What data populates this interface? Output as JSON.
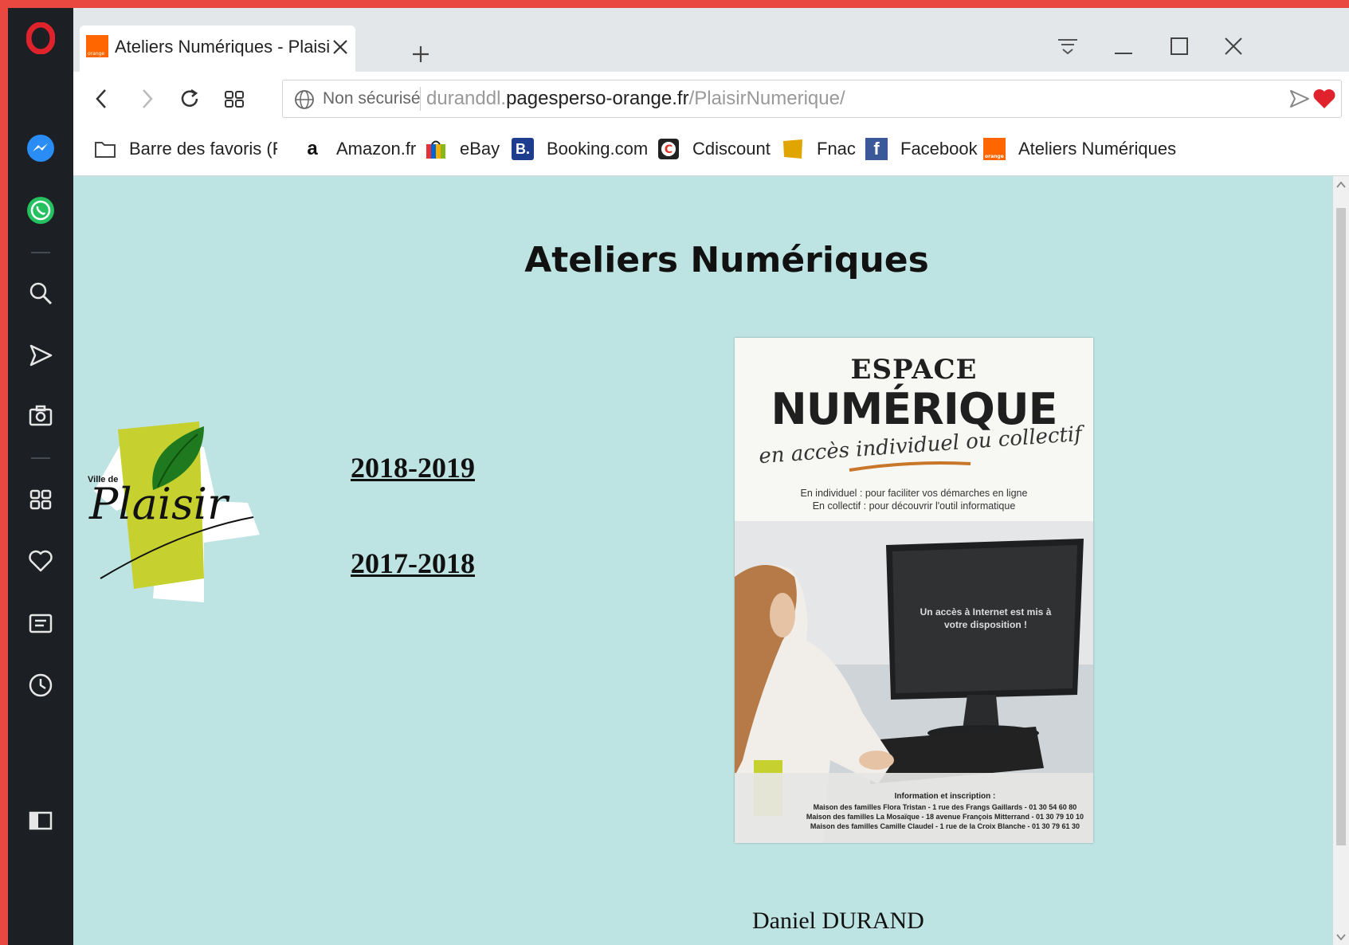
{
  "browser": {
    "tab": {
      "title": "Ateliers Numériques - Plaisir Numérique"
    },
    "address": {
      "security": "Non sécurisé",
      "url_prefix": "duranddl.",
      "url_domain": "pagesperso-orange.fr",
      "url_path": "/PlaisirNumerique/"
    },
    "bookmarks": [
      {
        "label": "Barre des favoris (Fire",
        "icon": "folder-icon"
      },
      {
        "label": "Amazon.fr",
        "icon": "amazon-icon"
      },
      {
        "label": "eBay",
        "icon": "ebay-icon"
      },
      {
        "label": "Booking.com",
        "icon": "booking-icon"
      },
      {
        "label": "Cdiscount",
        "icon": "cdiscount-icon"
      },
      {
        "label": "Fnac",
        "icon": "fnac-icon"
      },
      {
        "label": "Facebook",
        "icon": "facebook-icon"
      },
      {
        "label": "Ateliers Numériques",
        "icon": "orange-icon"
      }
    ]
  },
  "page": {
    "title": "Ateliers Numériques",
    "logo": {
      "small": "Ville de",
      "name": "Plaisir"
    },
    "links": [
      "2018-2019",
      "2017-2018"
    ],
    "flyer": {
      "line1": "ESPACE",
      "line2": "NUMÉRIQUE",
      "script": "en accès individuel ou collectif",
      "sub1": "En individuel : pour faciliter vos démarches en ligne",
      "sub2": "En collectif : pour découvrir l'outil informatique",
      "screen_text": "Un accès à Internet est mis à votre disposition !",
      "info_title": "Information et inscription :",
      "info_lines": [
        "Maison des familles Flora Tristan - 1 rue des Frangs Gaillards - 01 30 54 60 80",
        "Maison des familles La Mosaïque - 18 avenue François Mitterrand - 01 30 79 10 10",
        "Maison des familles Camille Claudel - 1 rue de la Croix Blanche - 01 30 79 61 30"
      ]
    },
    "author": "Daniel DURAND"
  },
  "colors": {
    "page_background": "#bde3e2",
    "sidebar": "#1c2024",
    "frame": "#e8483f",
    "logo_green": "#c6d12f"
  }
}
